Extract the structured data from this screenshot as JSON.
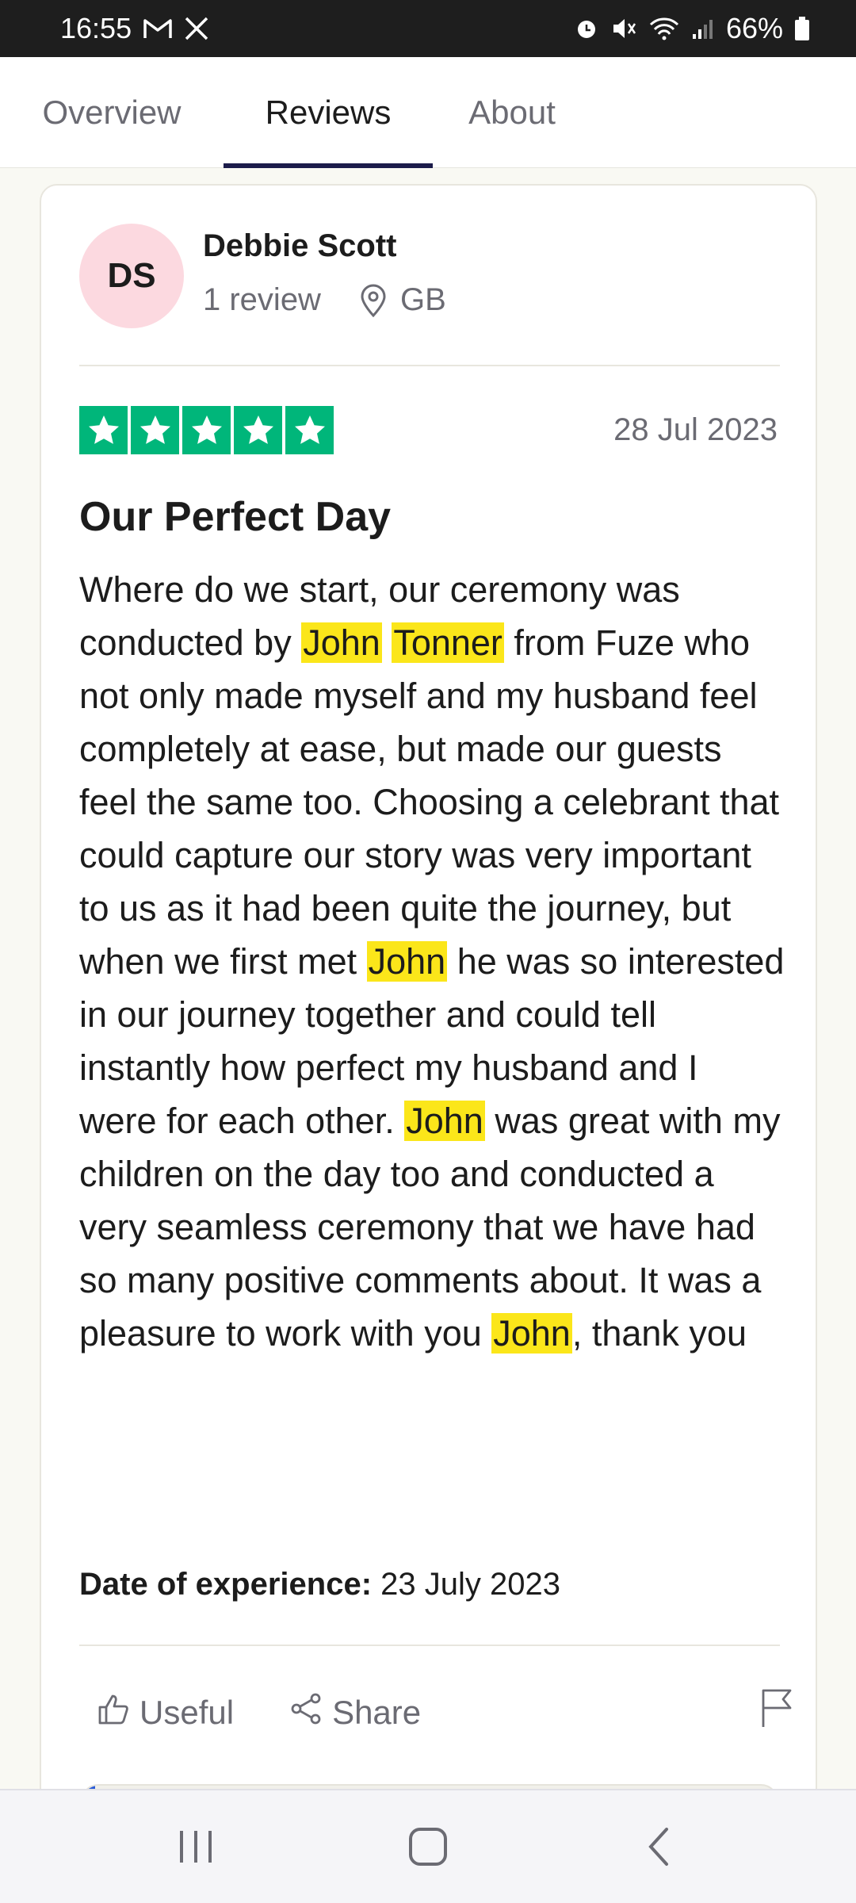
{
  "status_bar": {
    "time": "16:55",
    "battery": "66%",
    "left_icons": [
      "gmail-icon",
      "x-icon"
    ],
    "right_icons": [
      "alarm-icon",
      "mute-icon",
      "wifi-icon",
      "signal-icon",
      "battery-icon"
    ]
  },
  "tabs": [
    {
      "label": "Overview",
      "active": false
    },
    {
      "label": "Reviews",
      "active": true
    },
    {
      "label": "About",
      "active": false
    }
  ],
  "review": {
    "reviewer": {
      "initials": "DS",
      "name": "Debbie Scott",
      "review_count": "1 review",
      "country": "GB"
    },
    "rating": 5,
    "date": "28 Jul 2023",
    "title": "Our Perfect Day",
    "body_segments": [
      {
        "text": "Where do we start, our ceremony was conducted by ",
        "highlight": false
      },
      {
        "text": "John",
        "highlight": true
      },
      {
        "text": " ",
        "highlight": false
      },
      {
        "text": "Tonner",
        "highlight": true
      },
      {
        "text": " from Fuze who not only made myself and my husband feel completely at ease, but made our guests feel the same too. Choosing a celebrant that could capture our story was very important to us as it had been quite the journey, but when we first met ",
        "highlight": false
      },
      {
        "text": "John",
        "highlight": true
      },
      {
        "text": " he was so interested in our journey together and could tell instantly how perfect my husband and I were for each other. ",
        "highlight": false
      },
      {
        "text": "John",
        "highlight": true
      },
      {
        "text": " was great with my children on the day too and conducted a very seamless ceremony that we have had so many positive comments about. It was a pleasure to work with you ",
        "highlight": false
      },
      {
        "text": "John",
        "highlight": true
      },
      {
        "text": ", thank you",
        "highlight": false
      }
    ],
    "experience_label": "Date of experience:",
    "experience_date": "23 July 2023",
    "actions": {
      "useful_label": "Useful",
      "share_label": "Share"
    }
  },
  "colors": {
    "star_green": "#00b67a",
    "highlight_yellow": "#fbe61a",
    "avatar_pink": "#fcd9e0",
    "tab_underline": "#1c1c4a"
  },
  "nav_bar": {
    "buttons": [
      "recents-icon",
      "home-icon",
      "back-icon"
    ]
  }
}
